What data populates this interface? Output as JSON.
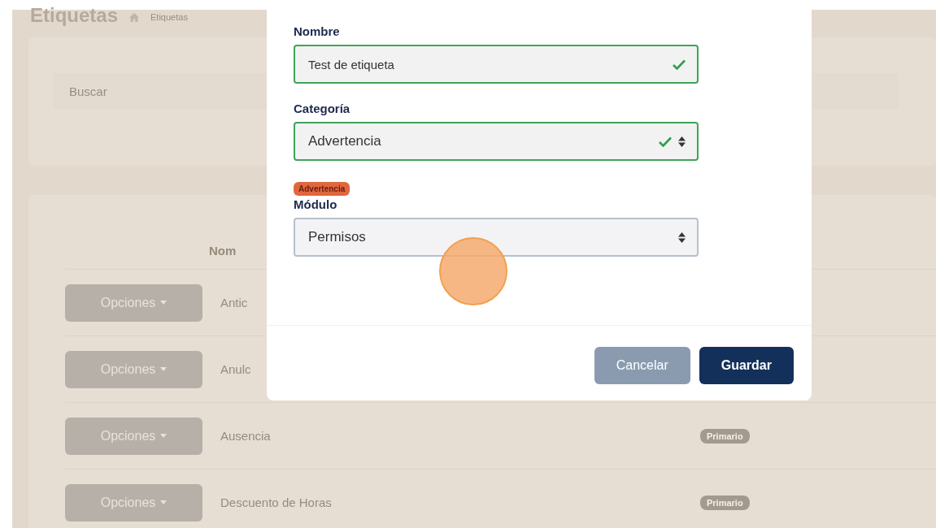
{
  "page": {
    "title": "Etiquetas",
    "breadcrumb": "Etiquetas"
  },
  "search": {
    "placeholder": "Buscar"
  },
  "table": {
    "columns": [
      "Nom"
    ],
    "rows": [
      {
        "action": "Opciones",
        "name": "Antic"
      },
      {
        "action": "Opciones",
        "name": "Anulc"
      },
      {
        "action": "Opciones",
        "name": "Ausencia",
        "badge": "Primario"
      },
      {
        "action": "Opciones",
        "name": "Descuento de Horas",
        "badge": "Primario"
      }
    ]
  },
  "modal": {
    "fields": [
      {
        "kind": "text",
        "label": "Nombre",
        "value": "Test de etiqueta",
        "valid": true
      },
      {
        "kind": "select",
        "label": "Categoría",
        "value": "Advertencia",
        "valid": true,
        "preview_badge": "Advertencia"
      },
      {
        "kind": "select",
        "label": "Módulo",
        "value": "Permisos",
        "valid": false
      }
    ],
    "buttons": [
      {
        "label": "Cancelar",
        "kind": "secondary"
      },
      {
        "label": "Guardar",
        "kind": "primary"
      }
    ]
  }
}
